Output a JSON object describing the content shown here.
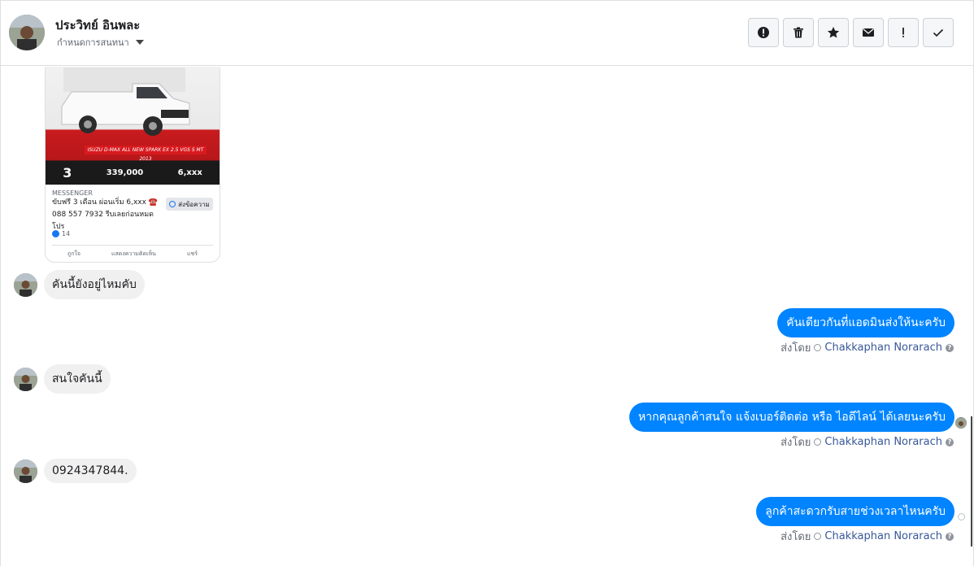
{
  "header": {
    "contact_name": "ประวิทย์ อินพละ",
    "assign_label": "กำหนดการสนทนา",
    "actions": [
      {
        "name": "report-spam-button",
        "icon": "alert-circle-icon"
      },
      {
        "name": "delete-button",
        "icon": "trash-icon"
      },
      {
        "name": "star-button",
        "icon": "star-icon"
      },
      {
        "name": "mark-unread-button",
        "icon": "envelope-icon"
      },
      {
        "name": "important-button",
        "icon": "exclamation-icon"
      },
      {
        "name": "mark-done-button",
        "icon": "check-icon"
      }
    ]
  },
  "ad_card": {
    "banner_text": "ISUZU D-MAX ALL NEW SPARK EX 2.5 VGS S MT 2013",
    "price_months": "3",
    "price_main": "339,000",
    "price_monthly": "6,xxx",
    "source": "MESSENGER",
    "description": "ขับฟรี 3 เดือน ผ่อนเริ่ม 6,xxx ☎️ 088 557 7932 รีบเลยก่อนหมดโปร",
    "send_label": "ส่งข้อความ",
    "like_count": "14",
    "react_like": "ถูกใจ",
    "react_comment": "แสดงความคิดเห็น",
    "react_share": "แชร์"
  },
  "messages": [
    {
      "direction": "in",
      "text": "คันนี้ยังอยู่ไหมคับ"
    },
    {
      "direction": "out",
      "text": "คันเดียวกันที่แอดมินส่งให้นะครับ",
      "sent_by_label": "ส่งโดย",
      "sender": "Chakkaphan Norarach"
    },
    {
      "direction": "in",
      "text": "สนใจคันนี้"
    },
    {
      "direction": "out",
      "text": "หากคุณลูกค้าสนใจ แจ้งเบอร์ติดต่อ หรือ ไอดีไลน์ ได้เลยนะครับ",
      "sent_by_label": "ส่งโดย",
      "sender": "Chakkaphan Norarach"
    },
    {
      "direction": "in",
      "text": "0924347844."
    },
    {
      "direction": "out",
      "text": "ลูกค้าสะดวกรับสายช่วงเวลาไหนครับ",
      "sent_by_label": "ส่งโดย",
      "sender": "Chakkaphan Norarach"
    }
  ],
  "colors": {
    "outgoing_bubble": "#0084ff",
    "incoming_bubble": "#f1f0f0",
    "sender_link": "#385898"
  }
}
